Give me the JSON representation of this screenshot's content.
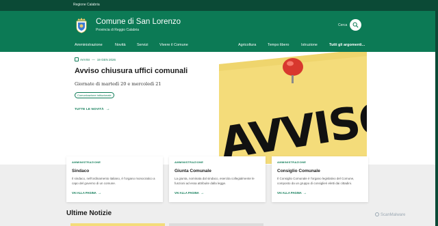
{
  "topbar": {
    "region": "Regione Calabria"
  },
  "header": {
    "title": "Comune di San Lorenzo",
    "subtitle": "Provincia di Reggio Calabria",
    "search_label": "Cerca",
    "crest_icon": "coat-of-arms-icon"
  },
  "nav": {
    "left": [
      "Amministrazione",
      "Novità",
      "Servizi",
      "Vivere il Comune"
    ],
    "right": [
      "Agricoltura",
      "Tempo libero",
      "Istruzione",
      "Tutti gli argomenti..."
    ]
  },
  "hero": {
    "tag": "AVVISI",
    "date": "19 GEN 2026",
    "title": "Avviso chiusura uffici comunali",
    "subtitle": "Giornate di martedì 20 e mercoledì 21",
    "chip": "Comunicazione istituzionale",
    "all_news": "TUTTE LE NOVITÀ",
    "image_word": "AVVISO"
  },
  "cards": [
    {
      "kicker": "AMMINISTRAZIONE",
      "title": "Sindaco",
      "desc": "Il sindaco, nell'ordinamento italiano, è l'organo monocratico a capo del governo di un comune.",
      "link": "VAI ALLA PAGINA"
    },
    {
      "kicker": "AMMINISTRAZIONE",
      "title": "Giunta Comunale",
      "desc": "La giunta, nominata dal sindaco, esercita collegialmente le funzioni ad essa attribuite dalla legge.",
      "link": "VAI ALLA PAGINA"
    },
    {
      "kicker": "AMMINISTRAZIONE",
      "title": "Consiglio Comunale",
      "desc": "Il Consiglio Comunale è l'organo legislativo del Comune, composto da un gruppo di consiglieri eletti dai cittadini.",
      "link": "VAI ALLA PAGINA"
    }
  ],
  "news": {
    "heading": "Ultime Notizie"
  },
  "watermark": "ScanMalware",
  "colors": {
    "primary": "#0c7a55",
    "dark": "#0b4a36",
    "poster": "#f4dc7a"
  }
}
